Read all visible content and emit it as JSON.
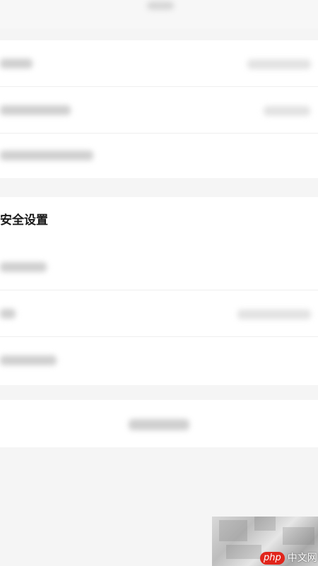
{
  "security_section": {
    "title": "安全设置"
  },
  "watermark": {
    "logo_text": "php",
    "site_text": "中文网"
  }
}
